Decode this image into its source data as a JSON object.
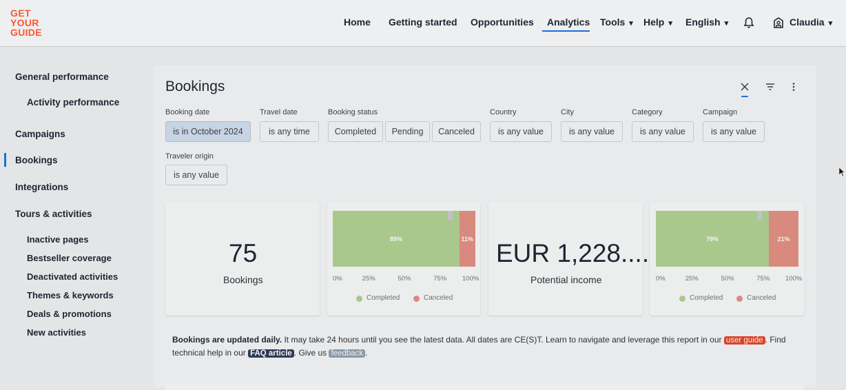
{
  "logo": {
    "line1": "GET",
    "line2": "YOUR",
    "line3": "GUIDE"
  },
  "nav": {
    "home": "Home",
    "getting_started": "Getting started",
    "opportunities": "Opportunities",
    "analytics": "Analytics",
    "tools": "Tools",
    "help": "Help",
    "language": "English",
    "user": "Claudia",
    "chevron": "⌄"
  },
  "sidebar": {
    "general_performance": "General performance",
    "activity_performance": "Activity performance",
    "campaigns": "Campaigns",
    "bookings": "Bookings",
    "integrations": "Integrations",
    "tours_activities": "Tours & activities",
    "inactive_pages": "Inactive pages",
    "bestseller_coverage": "Bestseller coverage",
    "deactivated_activities": "Deactivated activities",
    "themes_keywords": "Themes & keywords",
    "deals_promotions": "Deals & promotions",
    "new_activities": "New activities"
  },
  "page": {
    "title": "Bookings"
  },
  "filters": {
    "booking_date": {
      "label": "Booking date",
      "value": "is in October 2024"
    },
    "travel_date": {
      "label": "Travel date",
      "value": "is any time"
    },
    "booking_status": {
      "label": "Booking status",
      "options": [
        "Completed",
        "Pending",
        "Canceled"
      ]
    },
    "country": {
      "label": "Country",
      "value": "is any value"
    },
    "city": {
      "label": "City",
      "value": "is any value"
    },
    "category": {
      "label": "Category",
      "value": "is any value"
    },
    "campaign": {
      "label": "Campaign",
      "value": "is any value"
    },
    "traveler_origin": {
      "label": "Traveler origin",
      "value": "is any value"
    }
  },
  "tiles": {
    "bookings": {
      "value": "75",
      "label": "Bookings"
    },
    "income": {
      "value": "EUR 1,228....",
      "label": "Potential income"
    },
    "chart1": {
      "completed_pct": "89%",
      "canceled_pct": "11%",
      "completed": 0.89,
      "canceled": 0.11
    },
    "chart2": {
      "completed_pct": "79%",
      "canceled_pct": "21%",
      "completed": 0.79,
      "canceled": 0.21
    },
    "axis": [
      "0%",
      "25%",
      "50%",
      "75%",
      "100%"
    ],
    "legend": {
      "completed": "Completed",
      "canceled": "Canceled"
    }
  },
  "colors": {
    "completed": "#a9c88c",
    "canceled": "#d88a7e",
    "accent": "#1a6fd8",
    "brand": "#ff5533"
  },
  "info": {
    "bold": "Bookings are updated daily.",
    "text1": " It may take 24 hours until you see the latest data. All dates are CE(S)T. Learn to navigate and leverage this report in our ",
    "user_guide": "user guide",
    "text2": ". Find technical help in our ",
    "faq": "FAQ article",
    "text3": ". Give us ",
    "feedback": "feedback",
    "text4": "."
  }
}
